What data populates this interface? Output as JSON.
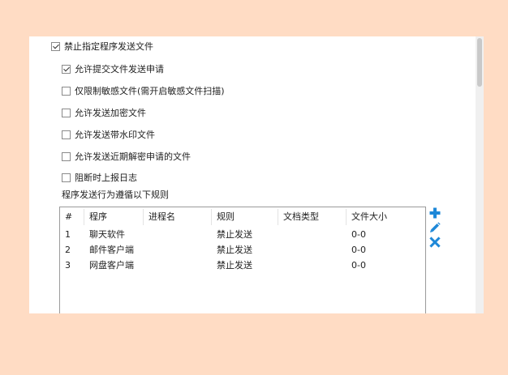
{
  "options": [
    {
      "label": "禁止指定程序发送文件",
      "checked": true
    },
    {
      "label": "允许提交文件发送申请",
      "checked": true
    },
    {
      "label": "仅限制敏感文件(需开启敏感文件扫描)",
      "checked": false
    },
    {
      "label": "允许发送加密文件",
      "checked": false
    },
    {
      "label": "允许发送带水印文件",
      "checked": false
    },
    {
      "label": "允许发送近期解密申请的文件",
      "checked": false
    },
    {
      "label": "阻断时上报日志",
      "checked": false
    }
  ],
  "rules_label": "程序发送行为遵循以下规则",
  "table": {
    "columns": [
      "#",
      "程序",
      "进程名",
      "规则",
      "文档类型",
      "文件大小"
    ],
    "rows": [
      [
        "1",
        "聊天软件",
        "",
        "禁止发送",
        "",
        "0-0"
      ],
      [
        "2",
        "邮件客户端",
        "",
        "禁止发送",
        "",
        "0-0"
      ],
      [
        "3",
        "网盘客户端",
        "",
        "禁止发送",
        "",
        "0-0"
      ]
    ]
  },
  "toolbar": {
    "icons": [
      "plus-icon",
      "pencil-icon",
      "close-icon"
    ],
    "icon_color": "#1E88D8"
  },
  "colors": {
    "background": "#FFDCC4",
    "panel": "#FFFFFF"
  }
}
